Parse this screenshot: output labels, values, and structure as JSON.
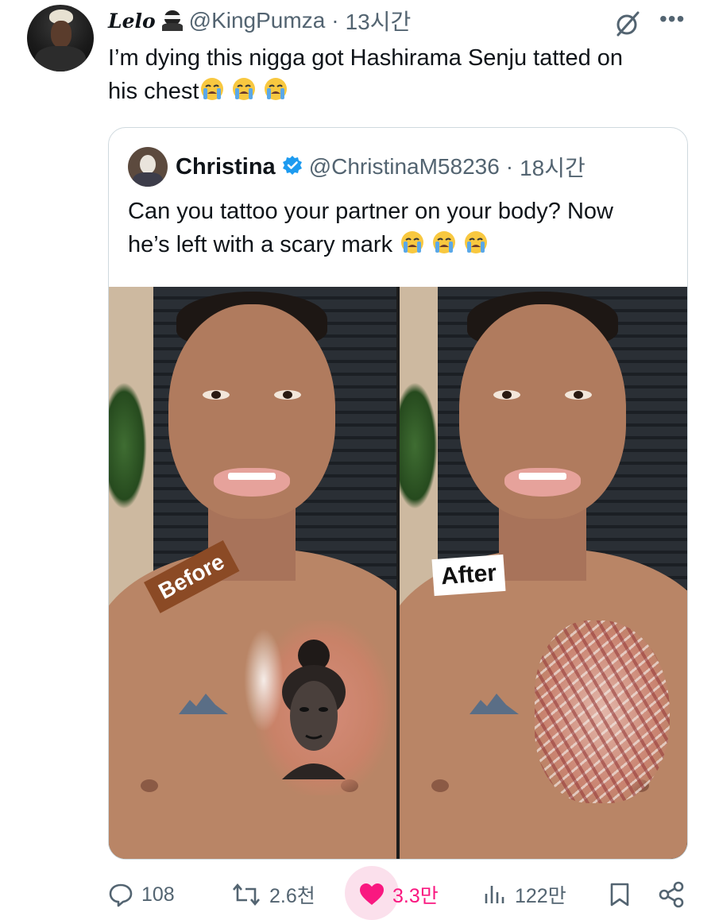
{
  "tweet": {
    "display_name": "Lelo",
    "handle": "@KingPumza",
    "dot": "·",
    "time": "13시간",
    "text_line1": "I’m dying this nigga got Hashirama Senju tatted on",
    "text_line2": "his chest",
    "emoji_count": 3
  },
  "quote": {
    "display_name": "Christina",
    "handle": "@ChristinaM58236",
    "dot": "·",
    "time": "18시간",
    "text_line1": "Can you tattoo your partner on your body? Now",
    "text_line2": "he’s left with a scary mark",
    "image": {
      "label_before": "Before",
      "label_after": "After"
    }
  },
  "actions": {
    "reply_count": "108",
    "retweet_count": "2.6천",
    "like_count": "3.3만",
    "view_count": "122만"
  },
  "colors": {
    "text": "#0f1419",
    "secondary": "#536471",
    "like": "#f91880",
    "verified": "#1d9bf0"
  },
  "icons": [
    "ninja-icon",
    "grok-icon",
    "more-icon",
    "verified-icon",
    "crying-emoji",
    "reply-icon",
    "retweet-icon",
    "like-icon",
    "views-icon",
    "bookmark-icon",
    "share-icon"
  ]
}
